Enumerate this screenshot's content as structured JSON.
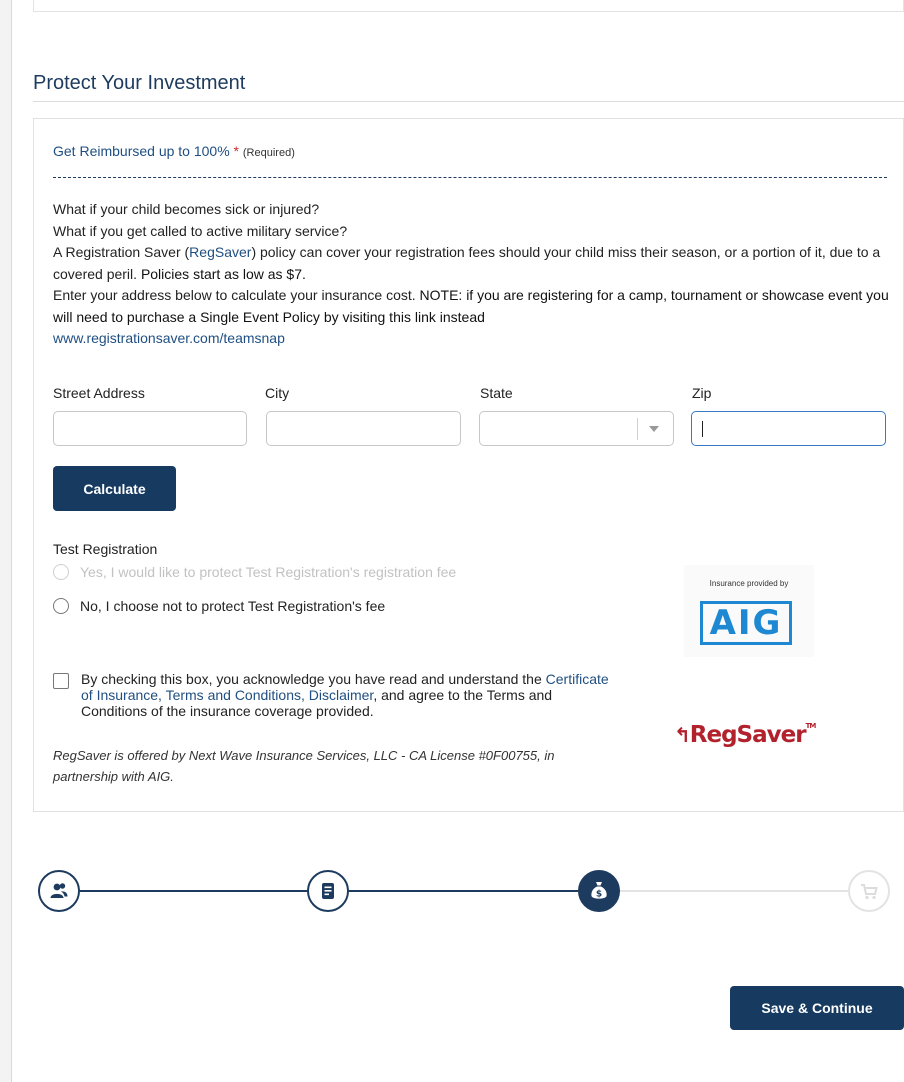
{
  "section": {
    "title": "Protect Your Investment"
  },
  "reimburse": {
    "label": "Get Reimbursed up to 100%",
    "required_star": "*",
    "required_text": "(Required)"
  },
  "description": {
    "q1": "What if your child becomes sick or injured?",
    "q2": "What if you get called to active military service?",
    "p1_pre": "A Registration Saver (",
    "p1_link": "RegSaver",
    "p1_post": ") policy can cover your registration fees should your child miss their season, or a portion of it, due to a covered peril.",
    "p1_bold": "Policies start as low as $7.",
    "p2_pre": "Enter your address below to calculate your insurance cost.",
    "p2_bold": "NOTE: if you are registering for a camp, tournament or showcase event you will need to purchase a Single Event Policy by visiting this link instead",
    "p2_link": "www.registrationsaver.com/teamsnap"
  },
  "form": {
    "street_label": "Street Address",
    "city_label": "City",
    "state_label": "State",
    "zip_label": "Zip",
    "street_value": "",
    "city_value": "",
    "state_value": "",
    "zip_value": ""
  },
  "calculate_label": "Calculate",
  "protection": {
    "heading": "Test Registration",
    "yes_option": "Yes, I would like to protect Test Registration's registration fee",
    "no_option": "No, I choose not to protect Test Registration's fee"
  },
  "aig": {
    "caption": "Insurance provided by",
    "logo_text": "AIG"
  },
  "acknowledge": {
    "pre": "By checking this box, you acknowledge you have read and understand the",
    "link": "Certificate of Insurance, Terms and Conditions, Disclaimer",
    "post": ", and agree to the Terms and Conditions of the insurance coverage provided."
  },
  "regsaver": {
    "logo_text": "RegSaver",
    "tm": "TM"
  },
  "note": "RegSaver is offered by Next Wave Insurance Services, LLC - CA License #0F00755, in partnership with AIG.",
  "steps": [
    {
      "icon": "users-icon",
      "state": "done"
    },
    {
      "icon": "document-icon",
      "state": "done"
    },
    {
      "icon": "money-bag-icon",
      "state": "current"
    },
    {
      "icon": "cart-icon",
      "state": "future"
    }
  ],
  "colors": {
    "primary": "#173a61",
    "link": "#1f4f82",
    "aig_blue": "#1e88d2",
    "regsaver_red": "#b2222d",
    "required_red": "#c6302e"
  },
  "save_label": "Save & Continue"
}
